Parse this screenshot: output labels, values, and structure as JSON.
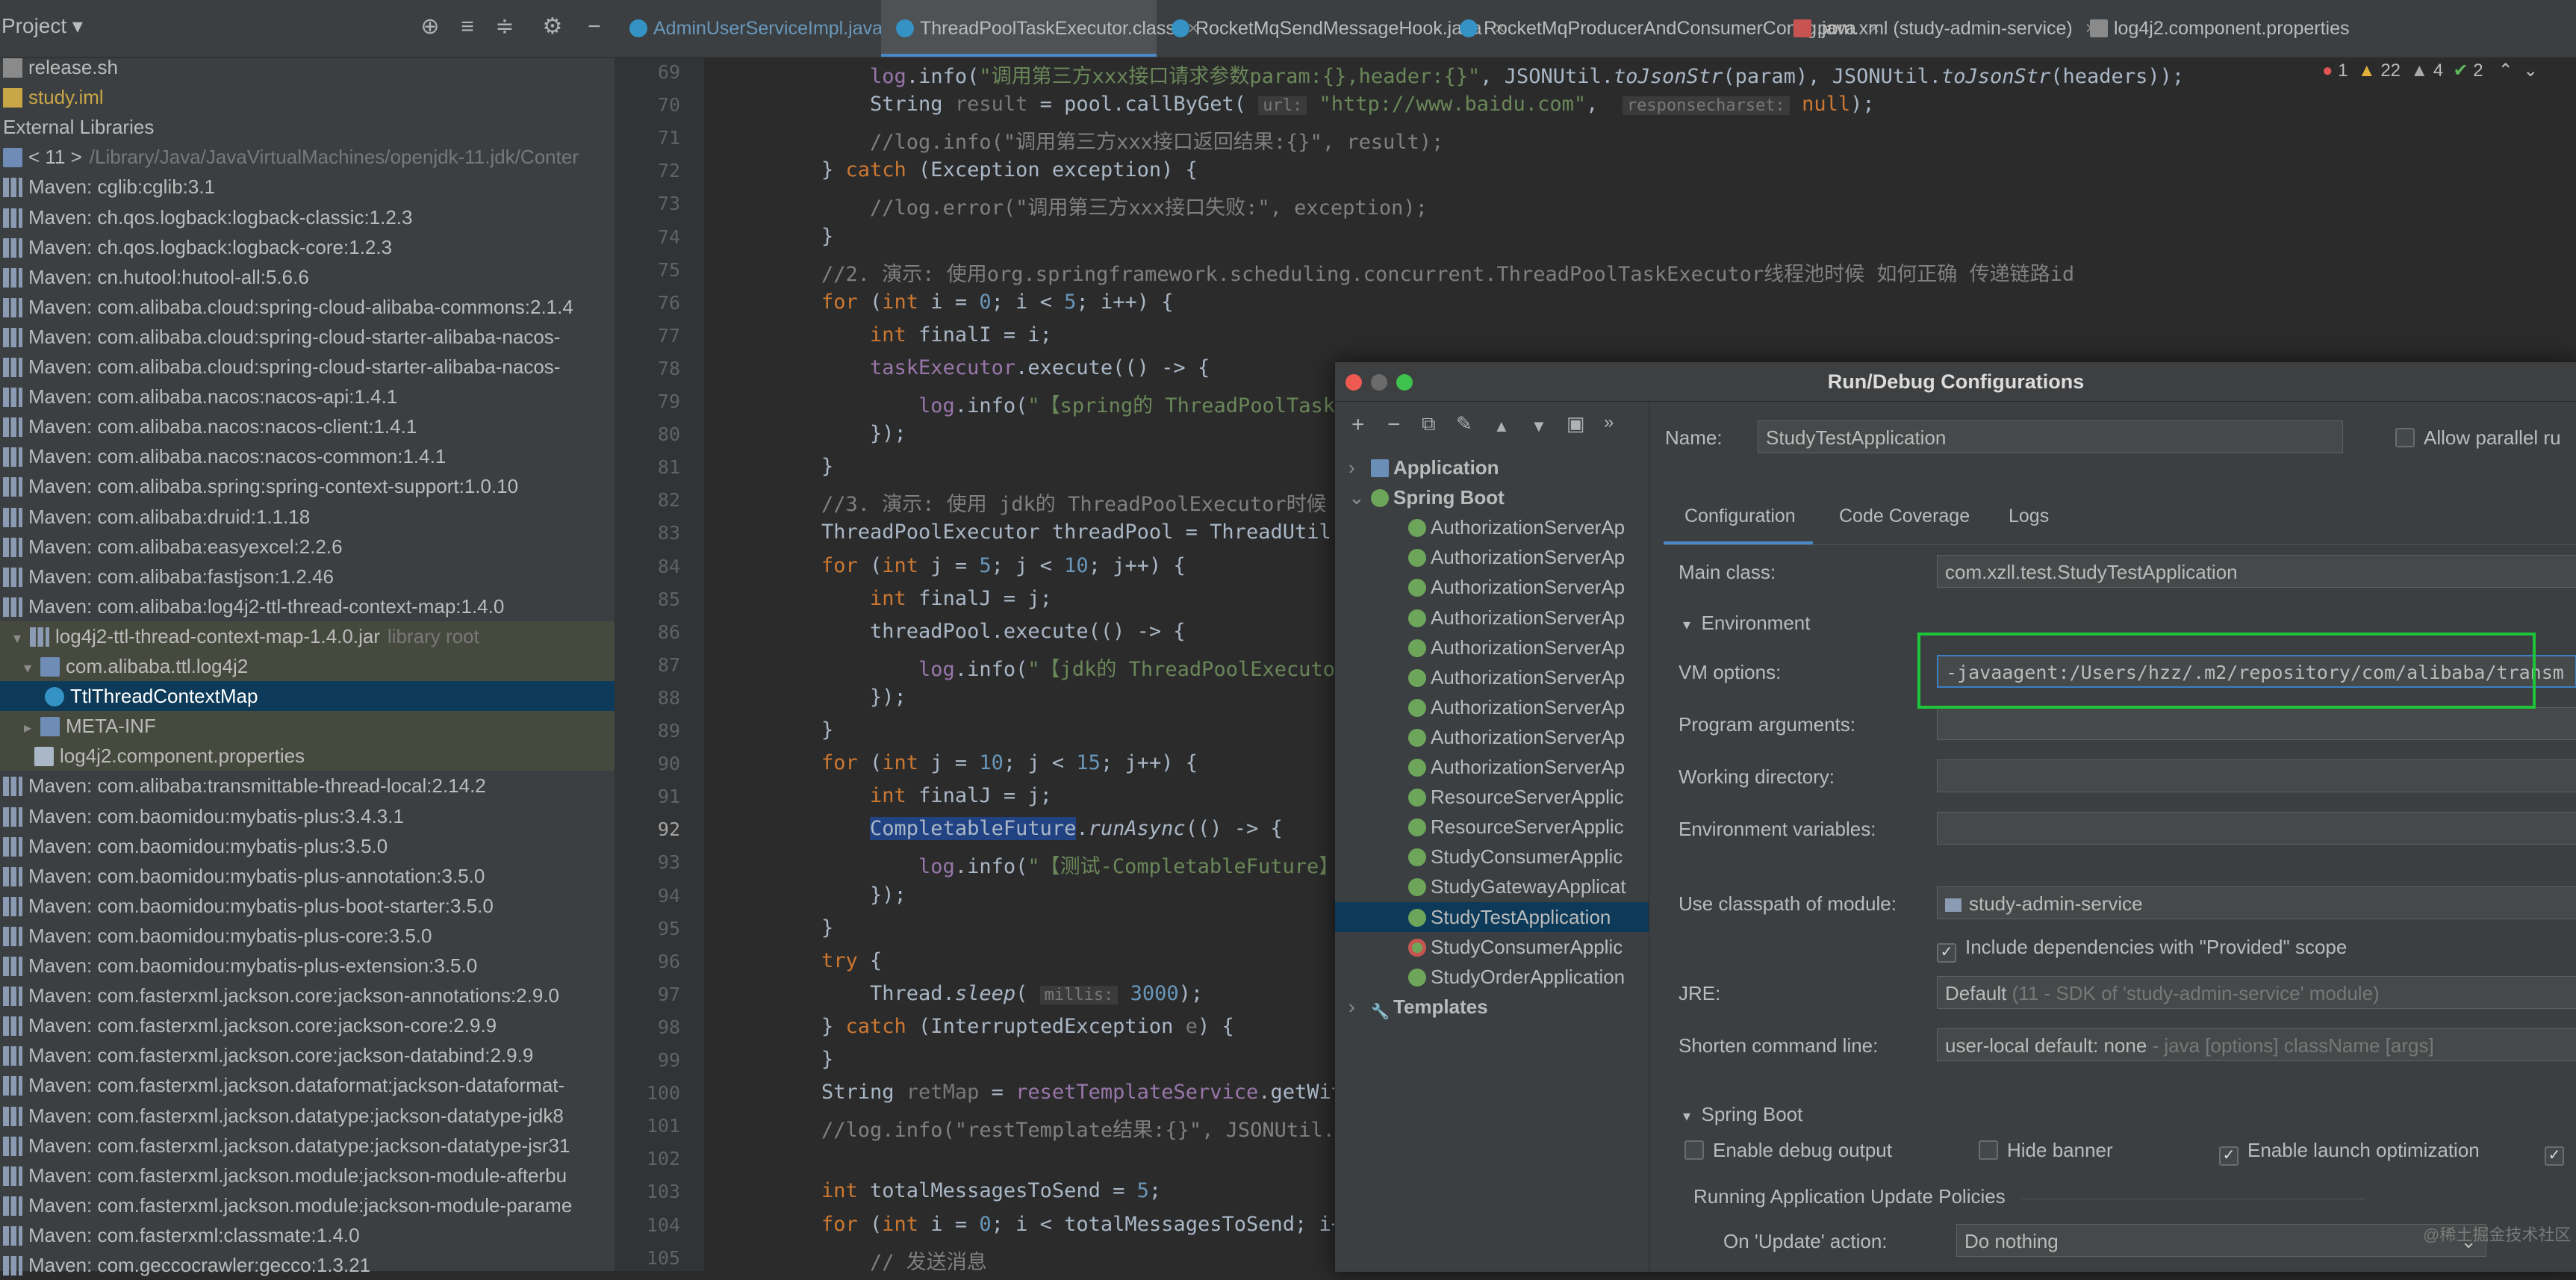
{
  "project": {
    "title": "Project",
    "tree": [
      {
        "label": "release.sh",
        "icon": "shell-file",
        "indent": 0
      },
      {
        "label": "study.iml",
        "icon": "iml-file",
        "indent": 0,
        "color": "#c9a747"
      },
      {
        "label": "External Libraries",
        "icon": "",
        "indent": 0
      },
      {
        "label": "< 11 >",
        "extra": "/Library/Java/JavaVirtualMachines/openjdk-11.jdk/Conter",
        "icon": "folder",
        "indent": 0
      },
      {
        "label": "Maven: cglib:cglib:3.1",
        "icon": "library",
        "indent": 0
      },
      {
        "label": "Maven: ch.qos.logback:logback-classic:1.2.3",
        "icon": "library",
        "indent": 0
      },
      {
        "label": "Maven: ch.qos.logback:logback-core:1.2.3",
        "icon": "library",
        "indent": 0
      },
      {
        "label": "Maven: cn.hutool:hutool-all:5.6.6",
        "icon": "library",
        "indent": 0
      },
      {
        "label": "Maven: com.alibaba.cloud:spring-cloud-alibaba-commons:2.1.4",
        "icon": "library",
        "indent": 0
      },
      {
        "label": "Maven: com.alibaba.cloud:spring-cloud-starter-alibaba-nacos-",
        "icon": "library",
        "indent": 0
      },
      {
        "label": "Maven: com.alibaba.cloud:spring-cloud-starter-alibaba-nacos-",
        "icon": "library",
        "indent": 0
      },
      {
        "label": "Maven: com.alibaba.nacos:nacos-api:1.4.1",
        "icon": "library",
        "indent": 0
      },
      {
        "label": "Maven: com.alibaba.nacos:nacos-client:1.4.1",
        "icon": "library",
        "indent": 0
      },
      {
        "label": "Maven: com.alibaba.nacos:nacos-common:1.4.1",
        "icon": "library",
        "indent": 0
      },
      {
        "label": "Maven: com.alibaba.spring:spring-context-support:1.0.10",
        "icon": "library",
        "indent": 0
      },
      {
        "label": "Maven: com.alibaba:druid:1.1.18",
        "icon": "library",
        "indent": 0
      },
      {
        "label": "Maven: com.alibaba:easyexcel:2.2.6",
        "icon": "library",
        "indent": 0
      },
      {
        "label": "Maven: com.alibaba:fastjson:1.2.46",
        "icon": "library",
        "indent": 0
      },
      {
        "label": "Maven: com.alibaba:log4j2-ttl-thread-context-map:1.4.0",
        "icon": "library",
        "indent": 0
      },
      {
        "label": "log4j2-ttl-thread-context-map-1.4.0.jar",
        "extra": "library root",
        "icon": "library",
        "indent": 1,
        "arrow": "▾",
        "hl": true
      },
      {
        "label": "com.alibaba.ttl.log4j2",
        "icon": "folder",
        "indent": 2,
        "arrow": "▾",
        "hl": true
      },
      {
        "label": "TtlThreadContextMap",
        "icon": "class",
        "indent": 4,
        "sel": true
      },
      {
        "label": "META-INF",
        "icon": "folder",
        "indent": 2,
        "arrow": "▸",
        "hl": true
      },
      {
        "label": "log4j2.component.properties",
        "icon": "file",
        "indent": 3,
        "hl": true
      },
      {
        "label": "Maven: com.alibaba:transmittable-thread-local:2.14.2",
        "icon": "library",
        "indent": 0
      },
      {
        "label": "Maven: com.baomidou:mybatis-plus:3.4.3.1",
        "icon": "library",
        "indent": 0
      },
      {
        "label": "Maven: com.baomidou:mybatis-plus:3.5.0",
        "icon": "library",
        "indent": 0
      },
      {
        "label": "Maven: com.baomidou:mybatis-plus-annotation:3.5.0",
        "icon": "library",
        "indent": 0
      },
      {
        "label": "Maven: com.baomidou:mybatis-plus-boot-starter:3.5.0",
        "icon": "library",
        "indent": 0
      },
      {
        "label": "Maven: com.baomidou:mybatis-plus-core:3.5.0",
        "icon": "library",
        "indent": 0
      },
      {
        "label": "Maven: com.baomidou:mybatis-plus-extension:3.5.0",
        "icon": "library",
        "indent": 0
      },
      {
        "label": "Maven: com.fasterxml.jackson.core:jackson-annotations:2.9.0",
        "icon": "library",
        "indent": 0
      },
      {
        "label": "Maven: com.fasterxml.jackson.core:jackson-core:2.9.9",
        "icon": "library",
        "indent": 0
      },
      {
        "label": "Maven: com.fasterxml.jackson.core:jackson-databind:2.9.9",
        "icon": "library",
        "indent": 0
      },
      {
        "label": "Maven: com.fasterxml.jackson.dataformat:jackson-dataformat-",
        "icon": "library",
        "indent": 0
      },
      {
        "label": "Maven: com.fasterxml.jackson.datatype:jackson-datatype-jdk8",
        "icon": "library",
        "indent": 0
      },
      {
        "label": "Maven: com.fasterxml.jackson.datatype:jackson-datatype-jsr31",
        "icon": "library",
        "indent": 0
      },
      {
        "label": "Maven: com.fasterxml.jackson.module:jackson-module-afterbu",
        "icon": "library",
        "indent": 0
      },
      {
        "label": "Maven: com.fasterxml.jackson.module:jackson-module-parame",
        "icon": "library",
        "indent": 0
      },
      {
        "label": "Maven: com.fasterxml:classmate:1.4.0",
        "icon": "library",
        "indent": 0
      },
      {
        "label": "Maven: com.geccocrawler:gecco:1.3.21",
        "icon": "library",
        "indent": 0
      }
    ]
  },
  "tabs": [
    {
      "label": "AdminUserServiceImpl.java"
    },
    {
      "label": "ThreadPoolTaskExecutor.class",
      "active": true
    },
    {
      "label": "RocketMqSendMessageHook.java"
    },
    {
      "label": "RocketMqProducerAndConsumerConfig.java"
    },
    {
      "label": "pom.xml (study-admin-service)"
    },
    {
      "label": "log4j2.component.properties"
    }
  ],
  "inspections": {
    "errors": "1",
    "warnings": "22",
    "weak": "4",
    "ok": "2"
  },
  "code": [
    {
      "n": "69",
      "html": "    <span class='fld'>log</span>.info(<span class='str'>\"调用第三方xxx接口请求参数param:{},header:{}\"</span>, JSONUtil.<span class='it'>toJsonStr</span>(param), JSONUtil.<span class='it'>toJsonStr</span>(headers));"
    },
    {
      "n": "70",
      "html": "    String <span class='dim'>result</span> = pool.callByGet( <span class='hint'>url:</span> <span class='str'>\"http://www.baidu.com\"</span>,  <span class='hint'>responsecharset:</span> <span class='kw'>null</span>);"
    },
    {
      "n": "71",
      "html": "    <span class='cm'>//log.info(\"调用第三方xxx接口返回结果:{}\", result);</span>"
    },
    {
      "n": "72",
      "html": "} <span class='kw'>catch</span> (Exception exception) {"
    },
    {
      "n": "73",
      "html": "    <span class='cm'>//log.error(\"调用第三方xxx接口失败:\", exception);</span>"
    },
    {
      "n": "74",
      "html": "}"
    },
    {
      "n": "75",
      "html": "<span class='cm'>//2. 演示: 使用org.springframework.scheduling.concurrent.ThreadPoolTaskExecutor线程池时候 如何正确 传递链路id</span>"
    },
    {
      "n": "76",
      "html": "<span class='kw'>for</span> (<span class='kw'>int</span> i = <span class='num'>0</span>; i &lt; <span class='num'>5</span>; i++) {"
    },
    {
      "n": "77",
      "html": "    <span class='kw'>int</span> finalI = i;"
    },
    {
      "n": "78",
      "html": "    <span class='fld'>taskExecutor</span>.execute(() -&gt; {"
    },
    {
      "n": "79",
      "html": "        <span class='fld'>log</span>.info(<span class='str'>\"【spring的 ThreadPoolTask</span>"
    },
    {
      "n": "80",
      "html": "    });"
    },
    {
      "n": "81",
      "html": "}"
    },
    {
      "n": "82",
      "html": "<span class='cm'>//3. 演示: 使用 jdk的 ThreadPoolExecutor时候</span>"
    },
    {
      "n": "83",
      "html": "ThreadPoolExecutor threadPool = ThreadUtil."
    },
    {
      "n": "84",
      "html": "<span class='kw'>for</span> (<span class='kw'>int</span> j = <span class='num'>5</span>; j &lt; <span class='num'>10</span>; j++) {"
    },
    {
      "n": "85",
      "html": "    <span class='kw'>int</span> finalJ = j;"
    },
    {
      "n": "86",
      "html": "    threadPool.execute(() -&gt; {"
    },
    {
      "n": "87",
      "html": "        <span class='fld'>log</span>.info(<span class='str'>\"【jdk的 ThreadPoolExecuto</span>"
    },
    {
      "n": "88",
      "html": "    });"
    },
    {
      "n": "89",
      "html": "}"
    },
    {
      "n": "90",
      "html": "<span class='kw'>for</span> (<span class='kw'>int</span> j = <span class='num'>10</span>; j &lt; <span class='num'>15</span>; j++) {"
    },
    {
      "n": "91",
      "html": "    <span class='kw'>int</span> finalJ = j;"
    },
    {
      "n": "92",
      "html": "    <span style='background:#214283'>CompletableFuture</span>.<span class='it'>runAsync</span>(() -&gt; {"
    },
    {
      "n": "93",
      "html": "        <span class='fld'>log</span>.info(<span class='str'>\"【测试-CompletableFuture】</span>"
    },
    {
      "n": "94",
      "html": "    });"
    },
    {
      "n": "95",
      "html": "}"
    },
    {
      "n": "96",
      "html": "<span class='kw'>try</span> {"
    },
    {
      "n": "97",
      "html": "    Thread.<span class='it'>sleep</span>( <span class='hint'>millis:</span> <span class='num'>3000</span>);"
    },
    {
      "n": "98",
      "html": "} <span class='kw'>catch</span> (InterruptedException <span class='dim'>e</span>) {"
    },
    {
      "n": "99",
      "html": "}"
    },
    {
      "n": "100",
      "html": "String <span class='dim'>retMap</span> = <span class='fld'>resetTemplateService</span>.getWit"
    },
    {
      "n": "101",
      "html": "<span class='cm'>//log.info(\"restTemplate结果:{}\", JSONUtil.</span>"
    },
    {
      "n": "102",
      "html": ""
    },
    {
      "n": "103",
      "html": "<span class='kw'>int</span> totalMessagesToSend = <span class='num'>5</span>;"
    },
    {
      "n": "104",
      "html": "<span class='kw'>for</span> (<span class='kw'>int</span> i = <span class='num'>0</span>; i &lt; totalMessagesToSend; i+"
    },
    {
      "n": "105",
      "html": "    <span class='cm'>// 发送消息</span>"
    }
  ],
  "dialog": {
    "title": "Run/Debug Configurations",
    "name_label": "Name:",
    "name_value": "StudyTestApplication",
    "allow_parallel": "Allow parallel ru",
    "tree": [
      {
        "label": "Application",
        "bold": true,
        "arrow": "›"
      },
      {
        "label": "Spring Boot",
        "bold": true,
        "arrow": "⌄"
      },
      {
        "label": "AuthorizationServerAp"
      },
      {
        "label": "AuthorizationServerAp"
      },
      {
        "label": "AuthorizationServerAp"
      },
      {
        "label": "AuthorizationServerAp"
      },
      {
        "label": "AuthorizationServerAp"
      },
      {
        "label": "AuthorizationServerAp"
      },
      {
        "label": "AuthorizationServerAp"
      },
      {
        "label": "AuthorizationServerAp"
      },
      {
        "label": "AuthorizationServerAp"
      },
      {
        "label": "ResourceServerApplic"
      },
      {
        "label": "ResourceServerApplic"
      },
      {
        "label": "StudyConsumerApplic"
      },
      {
        "label": "StudyGatewayApplicat"
      },
      {
        "label": "StudyTestApplication",
        "sel": true
      },
      {
        "label": "StudyConsumerApplic",
        "error": true
      },
      {
        "label": "StudyOrderApplication"
      },
      {
        "label": "Templates",
        "bold": true,
        "arrow": "›"
      }
    ],
    "tabs": [
      "Configuration",
      "Code Coverage",
      "Logs"
    ],
    "main_class_label": "Main class:",
    "main_class": "com.xzll.test.StudyTestApplication",
    "environment_label": "Environment",
    "vm_options_label": "VM options:",
    "vm_options": "-javaagent:/Users/hzz/.m2/repository/com/alibaba/transm",
    "program_args_label": "Program arguments:",
    "working_dir_label": "Working directory:",
    "env_vars_label": "Environment variables:",
    "classpath_label": "Use classpath of module:",
    "classpath_value": "study-admin-service",
    "include_deps": "Include dependencies with \"Provided\" scope",
    "jre_label": "JRE:",
    "jre_value": "Default",
    "jre_sub": "(11 - SDK of 'study-admin-service' module)",
    "shorten_label": "Shorten command line:",
    "shorten_value": "user-local default: none",
    "shorten_sub": "- java [options] className [args]",
    "spring_boot_label": "Spring Boot",
    "enable_debug": "Enable debug output",
    "hide_banner": "Hide banner",
    "enable_launch": "Enable launch optimization",
    "update_policies": "Running Application Update Policies",
    "on_update_label": "On 'Update' action:",
    "on_update_value": "Do nothing"
  },
  "watermark": "@稀土掘金技术社区"
}
